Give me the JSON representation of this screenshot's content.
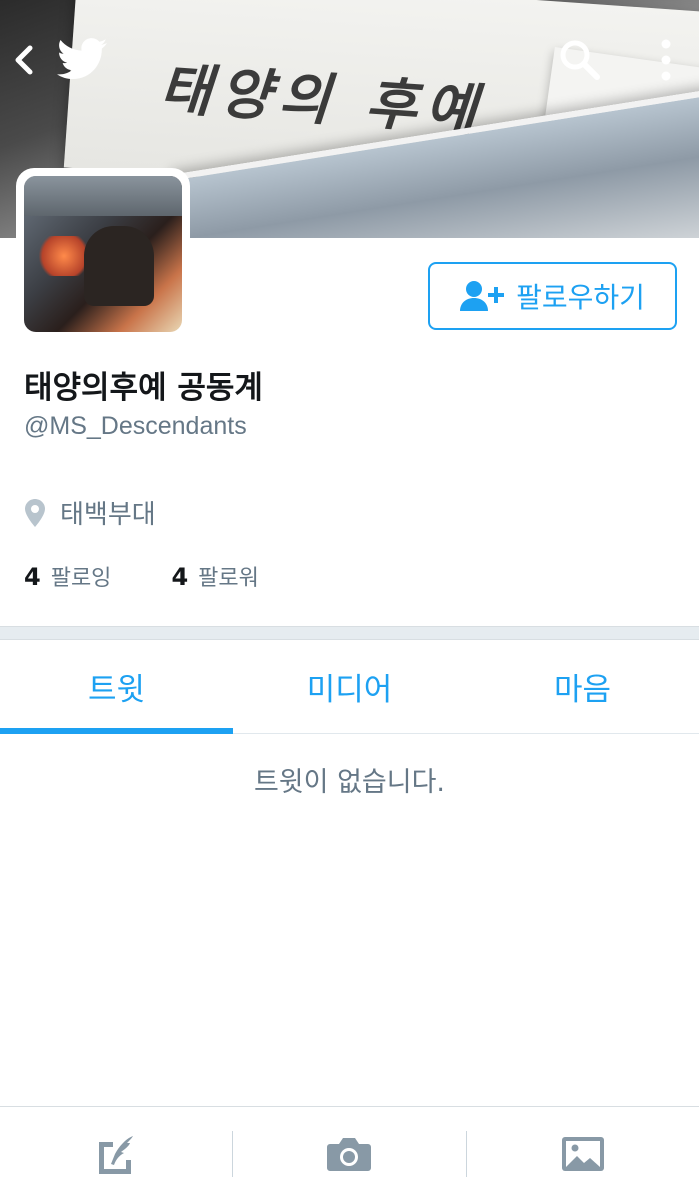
{
  "banner": {
    "calligraphy": "태양의 후예"
  },
  "top_bar": {
    "back_icon": "chevron-left-icon",
    "logo_icon": "twitter-bird-icon",
    "search_icon": "search-icon",
    "more_icon": "more-vertical-icon"
  },
  "profile": {
    "display_name": "태양의후예 공동계",
    "handle": "@MS_Descendants",
    "location": "태백부대",
    "follow_label": "팔로우하기",
    "following_count": "4",
    "following_label": "팔로잉",
    "followers_count": "4",
    "followers_label": "팔로워"
  },
  "tabs": [
    {
      "label": "트윗",
      "active": true
    },
    {
      "label": "미디어",
      "active": false
    },
    {
      "label": "마음",
      "active": false
    }
  ],
  "empty_message": "트윗이 없습니다.",
  "bottom_bar": {
    "compose_icon": "compose-tweet-icon",
    "camera_icon": "camera-icon",
    "image_icon": "image-icon"
  },
  "colors": {
    "accent": "#1da1f2",
    "secondary_text": "#657786",
    "primary_text": "#14171a"
  }
}
